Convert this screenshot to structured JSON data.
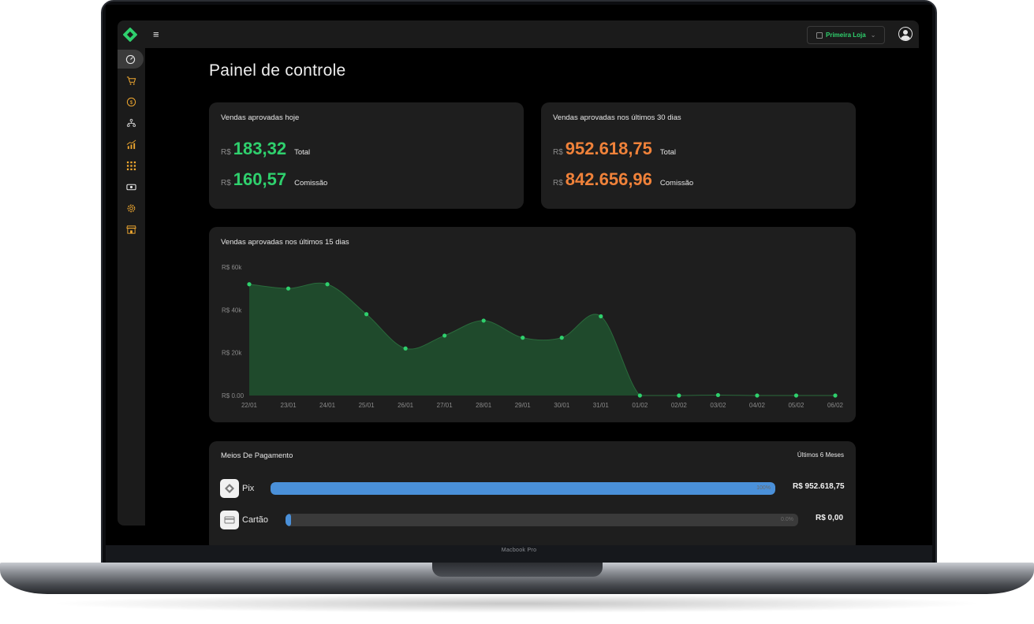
{
  "device_label": "Macbook Pro",
  "header": {
    "store": "Primeira Loja"
  },
  "sidebar": {
    "items": [
      {
        "icon": "dashboard-icon"
      },
      {
        "icon": "cart-icon"
      },
      {
        "icon": "dollar-icon"
      },
      {
        "icon": "affiliates-icon"
      },
      {
        "icon": "growth-icon"
      },
      {
        "icon": "apps-icon"
      },
      {
        "icon": "money-icon"
      },
      {
        "icon": "settings-icon"
      },
      {
        "icon": "store-icon"
      }
    ]
  },
  "page_title": "Painel de controle",
  "today": {
    "title": "Vendas aprovadas hoje",
    "currency": "R$",
    "total": "183,32",
    "total_label": "Total",
    "commission": "160,57",
    "commission_label": "Comissão"
  },
  "last30": {
    "title": "Vendas aprovadas nos últimos 30 dias",
    "currency": "R$",
    "total": "952.618,75",
    "total_label": "Total",
    "commission": "842.656,96",
    "commission_label": "Comissão"
  },
  "chart_card": {
    "title": "Vendas aprovadas nos últimos 15 dias"
  },
  "chart_data": {
    "type": "area",
    "title": "Vendas aprovadas nos últimos 15 dias",
    "x": [
      "22/01",
      "23/01",
      "24/01",
      "25/01",
      "26/01",
      "27/01",
      "28/01",
      "29/01",
      "30/01",
      "31/01",
      "01/02",
      "02/02",
      "03/02",
      "04/02",
      "05/02",
      "06/02"
    ],
    "series": [
      {
        "values": [
          52000,
          50000,
          52000,
          38000,
          22000,
          28000,
          35000,
          27000,
          27000,
          37000,
          0,
          0,
          200,
          0,
          0,
          0
        ]
      }
    ],
    "y_ticks": [
      "R$ 0.00",
      "R$ 20k",
      "R$ 40k",
      "R$ 60k"
    ],
    "ylim": [
      0,
      60000
    ],
    "fill_color": "#1f4a2c",
    "point_color": "#2fd06d",
    "grid": false
  },
  "payments": {
    "title": "Meios De Pagamento",
    "period": "Últimos 6 Meses",
    "methods": [
      {
        "name": "Pix",
        "icon": "pix-icon",
        "percent": 100,
        "percent_label": "100%",
        "amount": "R$ 952.618,75",
        "color": "#4a90d9"
      },
      {
        "name": "Cartão",
        "icon": "card-icon",
        "percent": 0,
        "percent_label": "0.0%",
        "amount": "R$ 0,00",
        "color": "#4a90d9"
      }
    ]
  }
}
